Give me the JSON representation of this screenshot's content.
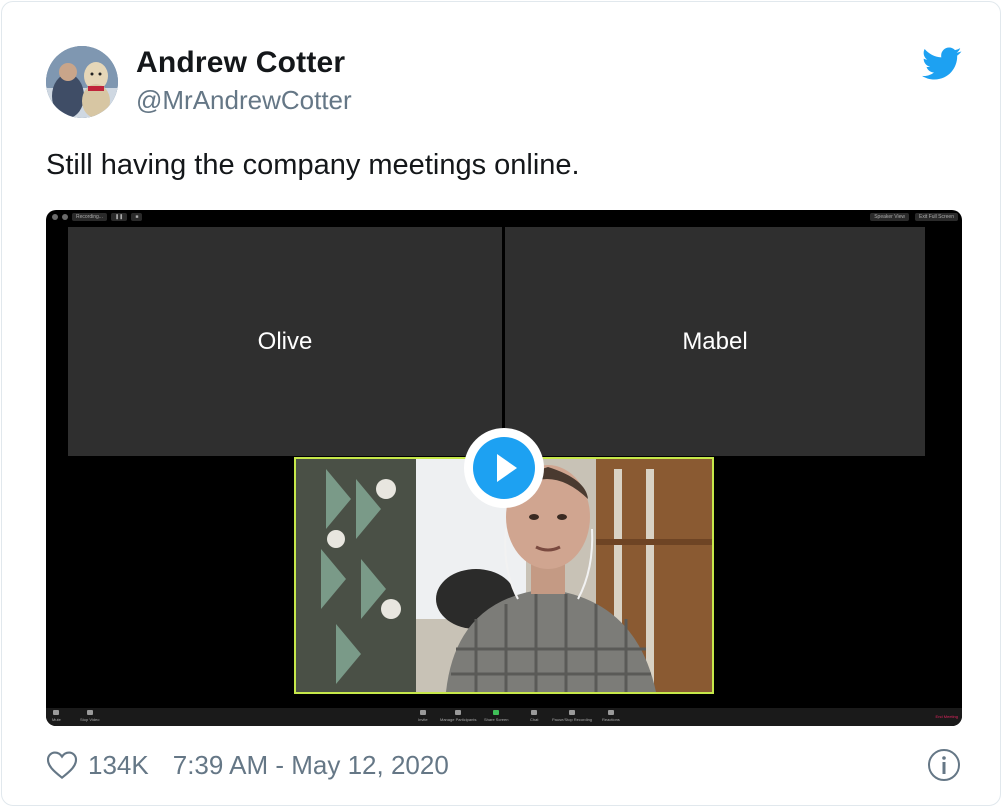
{
  "author": {
    "name": "Andrew Cotter",
    "handle": "@MrAndrewCotter"
  },
  "tweet": {
    "text": "Still having the company meetings online."
  },
  "video": {
    "topbar": {
      "recording_label": "Recording...",
      "speaker_view_label": "Speaker View",
      "exit_fullscreen_label": "Exit Full Screen"
    },
    "participants": [
      {
        "name": "Olive"
      },
      {
        "name": "Mabel"
      }
    ],
    "toolbar": {
      "mute": "Mute",
      "stop_video": "Stop Video",
      "invite": "Invite",
      "manage_participants": "Manage Participants",
      "share_screen": "Share Screen",
      "chat": "Chat",
      "recording": "Pause/Stop Recording",
      "reactions": "Reactions",
      "end_meeting": "End Meeting"
    },
    "highlight_color": "#c6e84a"
  },
  "engagement": {
    "likes": "134K",
    "timestamp": "7:39 AM - May 12, 2020"
  },
  "colors": {
    "accent": "#1da1f2",
    "secondary_text": "#657786"
  }
}
